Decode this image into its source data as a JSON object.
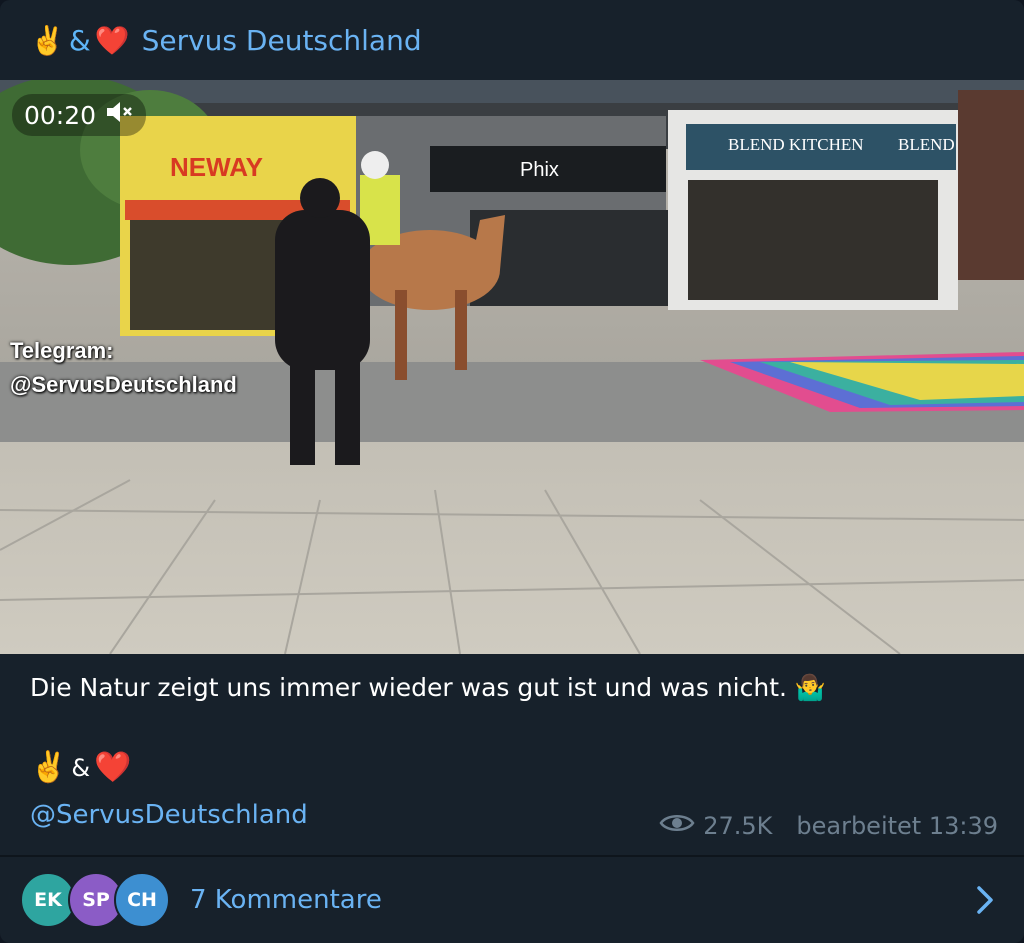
{
  "header": {
    "emoji_victory": "✌️",
    "amp": "&",
    "emoji_heart": "❤️",
    "channel_title": "Servus Deutschland"
  },
  "video": {
    "time": "00:20",
    "watermark_line1": "Telegram:",
    "watermark_line2": "@ServusDeutschland",
    "signs": {
      "shop1": "NEWAY",
      "shop2": "Phix",
      "shop3": "BLEND KITCHEN",
      "shop4": "BLEND KI"
    }
  },
  "message": {
    "text": "Die Natur zeigt uns immer wieder was gut ist und was nicht. 🤷‍♂️",
    "signature_victory": "✌️",
    "signature_amp": "&",
    "signature_heart": "❤️",
    "mention": "@ServusDeutschland",
    "views": "27.5K",
    "edited": "bearbeitet 13:39"
  },
  "footer": {
    "avatars": [
      {
        "initials": "EK",
        "color": "#2ea5a0"
      },
      {
        "initials": "SP",
        "color": "#8b5cc6"
      },
      {
        "initials": "CH",
        "color": "#3d8fd1"
      }
    ],
    "comments_label": "7 Kommentare"
  }
}
